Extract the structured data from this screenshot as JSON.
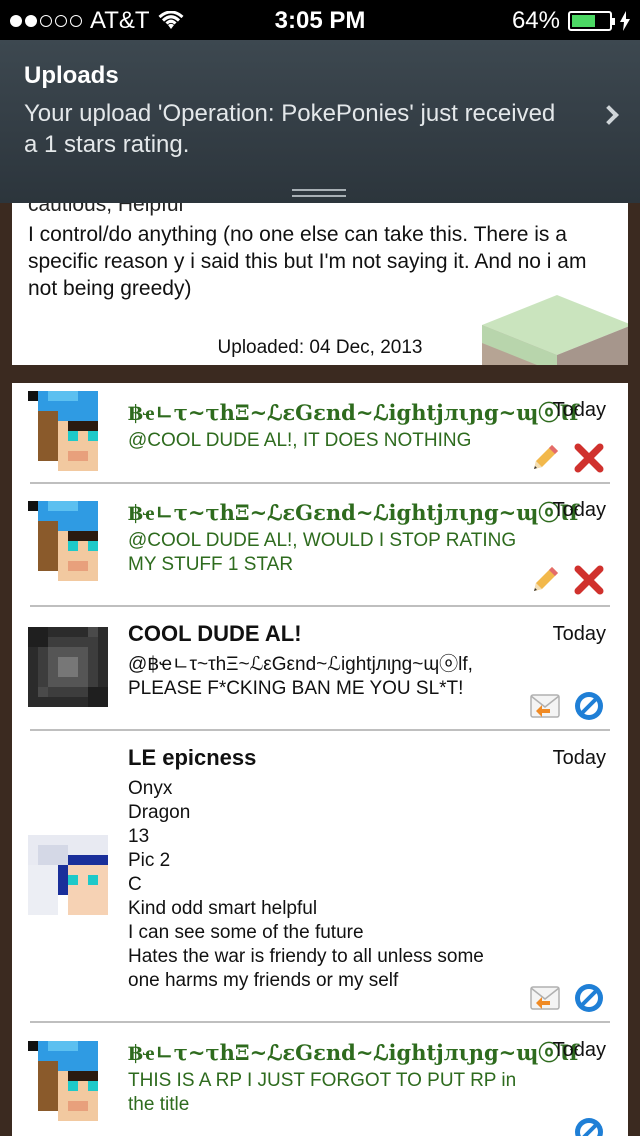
{
  "status_bar": {
    "carrier": "AT&T",
    "time": "3:05 PM",
    "battery": "64%",
    "signal_full": 2,
    "signal_total": 5
  },
  "notification": {
    "title": "Uploads",
    "message": "Your upload 'Operation: PokePonies' just received a 1 stars rating."
  },
  "description": {
    "cut_line": "cautious, Helpful",
    "body": "I control/do anything (no one else can take this. There is a specific reason y i said this but I'm not saying it. And no i am not being greedy)",
    "uploaded": "Uploaded: 04 Dec, 2013"
  },
  "comments": [
    {
      "author": "฿ҽㄴτ~τhΞ~ℒεGεnd~ℒightϳлιɲg~ɰⓞƖf",
      "date": "Today",
      "text": "@COOL DUDE AL!, IT DOES NOTHING",
      "edit_icon": "pencil-icon",
      "delete_icon": "delete-x-icon"
    },
    {
      "author": "฿ҽㄴτ~τhΞ~ℒεGεnd~ℒightϳлιɲg~ɰⓞƖf",
      "date": "Today",
      "text": "@COOL DUDE AL!, WOULD I STOP RATING MY STUFF 1 STAR",
      "edit_icon": "pencil-icon",
      "delete_icon": "delete-x-icon"
    },
    {
      "author": "COOL DUDE AL!",
      "date": "Today",
      "text": "@฿ҽㄴτ~τhΞ~ℒεGεnd~ℒightϳлιɲg~ɰⓞƖf, PLEASE F*CKING BAN ME YOU SL*T!",
      "reply_icon": "reply-icon",
      "block_icon": "block-icon"
    },
    {
      "author": "LE epicness",
      "date": "Today",
      "lines": [
        "Onyx",
        "Dragon",
        "13",
        "Pic 2",
        "C",
        "Kind odd smart helpful",
        "I can see some of the future",
        "Hates the war is friendy to all unless some",
        "one harms my friends or my self"
      ],
      "reply_icon": "reply-icon",
      "block_icon": "block-icon"
    },
    {
      "author": "฿ҽㄴτ~τhΞ~ℒεGεnd~ℒightϳлιɲg~ɰⓞƖf",
      "date": "Today",
      "text": "THIS IS A RP I JUST FORGOT TO PUT RP in the title",
      "block_icon": "block-icon"
    }
  ],
  "colors": {
    "accent_green": "#2e6b1e",
    "notification_bg": "#333d44",
    "background": "#3b2a20",
    "delete_red": "#d0312d",
    "block_blue": "#1f7fd6"
  }
}
